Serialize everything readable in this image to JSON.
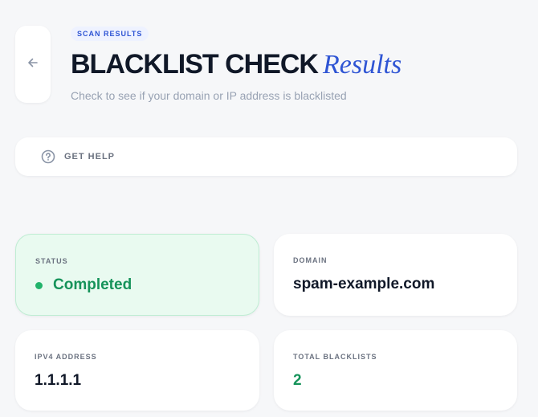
{
  "header": {
    "badge": "SCAN RESULTS",
    "title_main": "BLACKLIST CHECK",
    "title_accent": "Results",
    "subtitle": "Check to see if your domain or IP address is blacklisted"
  },
  "help": {
    "label": "GET HELP",
    "icon": "question-circle-icon"
  },
  "back": {
    "icon": "arrow-left-icon"
  },
  "cards": {
    "status": {
      "label": "STATUS",
      "value": "Completed"
    },
    "domain": {
      "label": "DOMAIN",
      "value": "spam-example.com"
    },
    "ipv4": {
      "label": "IPV4 ADDRESS",
      "value": "1.1.1.1"
    },
    "total_blacklists": {
      "label": "TOTAL BLACKLISTS",
      "value": "2"
    }
  },
  "colors": {
    "accent": "#2f55d4",
    "success": "#16935a",
    "success_bg": "#e9faf0",
    "muted": "#98a2b3"
  }
}
